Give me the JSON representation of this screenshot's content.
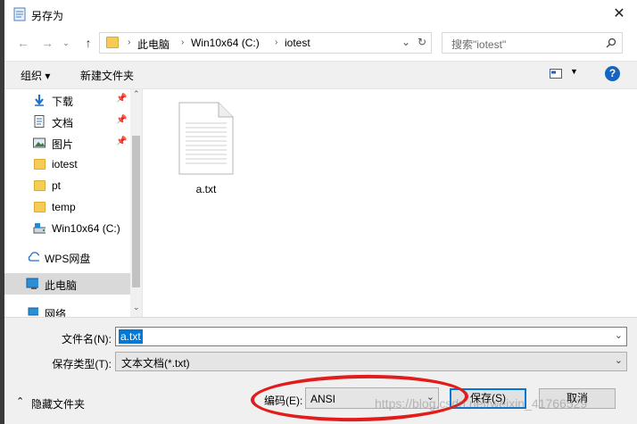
{
  "window": {
    "title": "另存为"
  },
  "address": {
    "segments": [
      "此电脑",
      "Win10x64 (C:)",
      "iotest"
    ],
    "search_placeholder": "搜索\"iotest\""
  },
  "toolbar": {
    "organize": "组织 ▾",
    "new_folder": "新建文件夹",
    "help": "?"
  },
  "nav": {
    "items": [
      {
        "label": "下载"
      },
      {
        "label": "文档"
      },
      {
        "label": "图片"
      },
      {
        "label": "iotest"
      },
      {
        "label": "pt"
      },
      {
        "label": "temp"
      },
      {
        "label": "Win10x64 (C:)"
      },
      {
        "label": "WPS网盘"
      },
      {
        "label": "此电脑"
      },
      {
        "label": "网络"
      }
    ]
  },
  "files": [
    {
      "name": "a.txt"
    }
  ],
  "form": {
    "filename_label": "文件名(N):",
    "filename_value": "a.txt",
    "filetype_label": "保存类型(T):",
    "filetype_value": "文本文档(*.txt)",
    "hide_folders": "隐藏文件夹",
    "encoding_label": "编码(E):",
    "encoding_value": "ANSI",
    "save": "保存(S)",
    "cancel": "取消"
  },
  "watermark": "https://blog.csdn.net/weixin_41766529",
  "colors": {
    "accent": "#0078d7",
    "annotation": "#e21b1b",
    "folder": "#f5cc54"
  }
}
